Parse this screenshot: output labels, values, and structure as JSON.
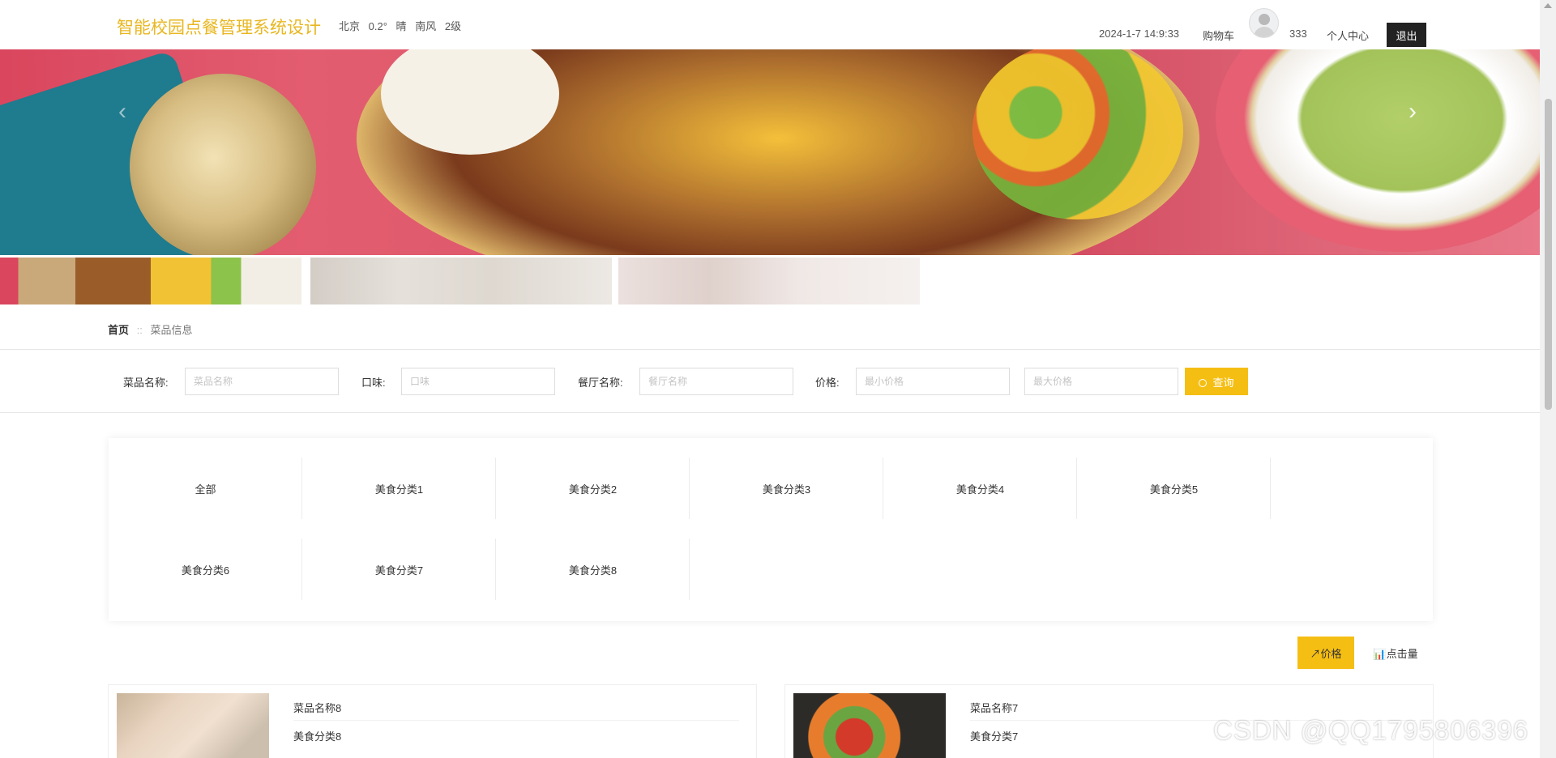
{
  "header": {
    "site_title": "智能校园点餐管理系统设计",
    "weather": {
      "city": "北京",
      "temperature": "0.2°",
      "condition": "晴",
      "wind": "南风",
      "wind_level": "2级"
    },
    "datetime": "2024-1-7 14:9:33",
    "cart_label": "购物车",
    "username": "333",
    "profile_label": "个人中心",
    "logout_label": "退出"
  },
  "banner": {
    "prev_icon": "‹",
    "next_icon": "›"
  },
  "breadcrumb": {
    "home": "首页",
    "separator": "::",
    "current": "菜品信息"
  },
  "search": {
    "dish_name_label": "菜品名称:",
    "dish_name_placeholder": "菜品名称",
    "taste_label": "口味:",
    "taste_placeholder": "口味",
    "restaurant_label": "餐厅名称:",
    "restaurant_placeholder": "餐厅名称",
    "price_label": "价格:",
    "min_price_placeholder": "最小价格",
    "max_price_placeholder": "最大价格",
    "button_label": "查询"
  },
  "categories": [
    "全部",
    "美食分类1",
    "美食分类2",
    "美食分类3",
    "美食分类4",
    "美食分类5",
    "美食分类6",
    "美食分类7",
    "美食分类8"
  ],
  "sort": {
    "price_label": "价格",
    "clicks_label": "点击量"
  },
  "dishes": [
    {
      "name": "菜品名称8",
      "category": "美食分类8"
    },
    {
      "name": "菜品名称7",
      "category": "美食分类7"
    }
  ],
  "watermark": "CSDN @QQ1795806396",
  "colors": {
    "accent": "#f5be13",
    "title": "#e8b720",
    "logout_bg": "#222222"
  }
}
